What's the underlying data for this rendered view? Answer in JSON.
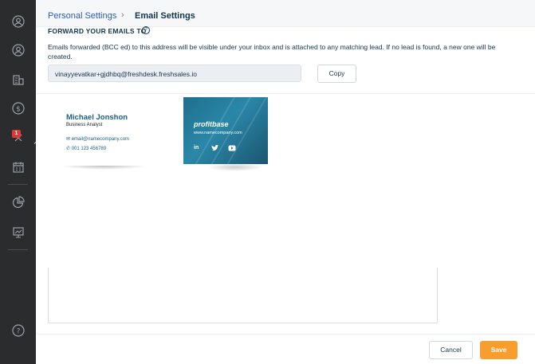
{
  "breadcrumb": {
    "parent": "Personal Settings",
    "separator": "›",
    "current": "Email Settings"
  },
  "forward": {
    "title": "FORWARD YOUR EMAILS TO",
    "help": "?",
    "description": "Emails forwarded (BCC ed) to this address will be visible under your inbox and is attached to any matching lead. If no lead is found, a new one will be created.",
    "email_value": "vinayyevatkar+gjdhbq@freshdesk.freshsales.io",
    "copy_label": "Copy"
  },
  "sidebar": {
    "notification_count": "1"
  },
  "signature": {
    "name": "Michael Jonshon",
    "role": "Business Analyst",
    "email": "email@namecompany.com",
    "phone": "001 123 456789"
  },
  "brand": {
    "name": "profitbase",
    "url": "www.namecompany.com",
    "social": [
      "in",
      "t",
      "yt"
    ]
  },
  "footer": {
    "cancel_label": "Cancel",
    "save_label": "Save"
  },
  "colors": {
    "accent": "#f99d2e",
    "link": "#2c5cc5",
    "sidebar": "#2b2c2e",
    "badge": "#e43538"
  }
}
